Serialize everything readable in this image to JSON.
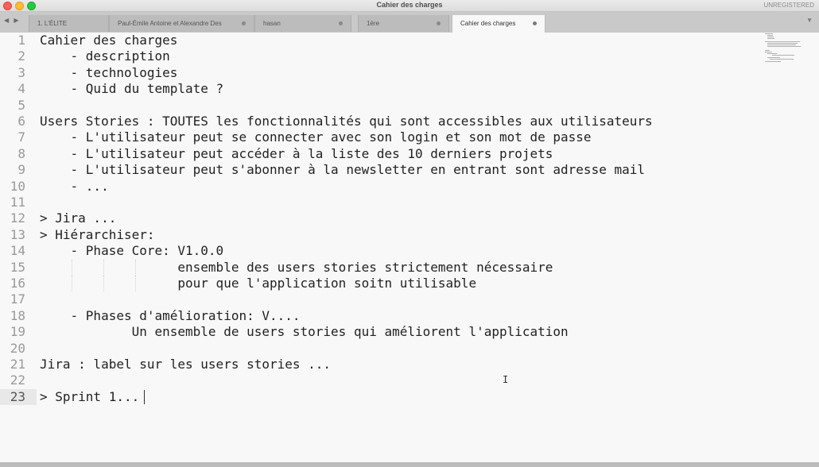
{
  "window": {
    "title": "Cahier des charges",
    "license": "UNREGISTERED"
  },
  "tabs": [
    {
      "label": "1. L'ÉLITE",
      "active": false
    },
    {
      "label": "Paul-Émile Antoine et Alexandre Des",
      "active": false
    },
    {
      "label": "hasan",
      "active": false
    },
    {
      "label": "1ère",
      "active": false
    },
    {
      "label": "Cahier des charges",
      "active": true
    }
  ],
  "editor": {
    "current_line": 23,
    "lines": [
      "Cahier des charges",
      "    - description",
      "    - technologies",
      "    - Quid du template ?",
      "",
      "Users Stories : TOUTES les fonctionnalités qui sont accessibles aux utilisateurs",
      "    - L'utilisateur peut se connecter avec son login et son mot de passe",
      "    - L'utilisateur peut accéder à la liste des 10 derniers projets",
      "    - L'utilisateur peut s'abonner à la newsletter en entrant sont adresse mail",
      "    - ...",
      "",
      "> Jira ...",
      "> Hiérarchiser:",
      "    - Phase Core: V1.0.0",
      "                  ensemble des users stories strictement nécessaire",
      "                  pour que l'application soitn utilisable",
      "",
      "    - Phases d'amélioration: V....",
      "            Un ensemble de users stories qui améliorent l'application",
      "",
      "Jira : label sur les users stories ...",
      "",
      "> Sprint 1..."
    ]
  },
  "colors": {
    "background": "#f8f8f8",
    "text": "#222222",
    "line_number": "#999999",
    "tabbar": "#c9c9c9"
  }
}
